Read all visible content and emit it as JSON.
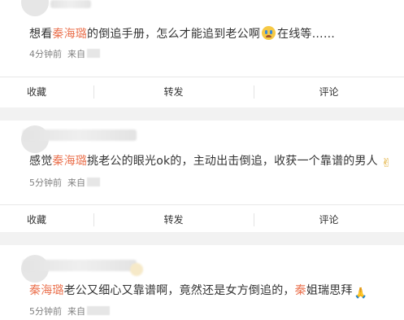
{
  "comments": [
    {
      "pre": "想看",
      "name": "秦海璐",
      "post": "的倒追手册，怎么才能追到老公啊",
      "emoji": "crying-face",
      "tail": "在线等……",
      "time": "4分钟前",
      "from": "来自"
    },
    {
      "pre": "感觉",
      "name": "秦海璐",
      "post": "挑老公的眼光ok的，主动出击倒追，收获一个靠谱的男人",
      "emoji": "victory-hand",
      "time": "5分钟前",
      "from": "来自"
    },
    {
      "name": "秦海璐",
      "post": "老公又细心又靠谱啊，竟然还是女方倒追的，",
      "name2": "秦",
      "post2": "姐瑞思拜",
      "emoji": "folded-hands",
      "time": "5分钟前",
      "from": "来自"
    }
  ],
  "actions": {
    "collect": "收藏",
    "repost": "转发",
    "comment": "评论"
  },
  "colors": {
    "highlight": "#eb7350",
    "text": "#333333",
    "meta": "#808080",
    "background": "#f2f2f2"
  }
}
